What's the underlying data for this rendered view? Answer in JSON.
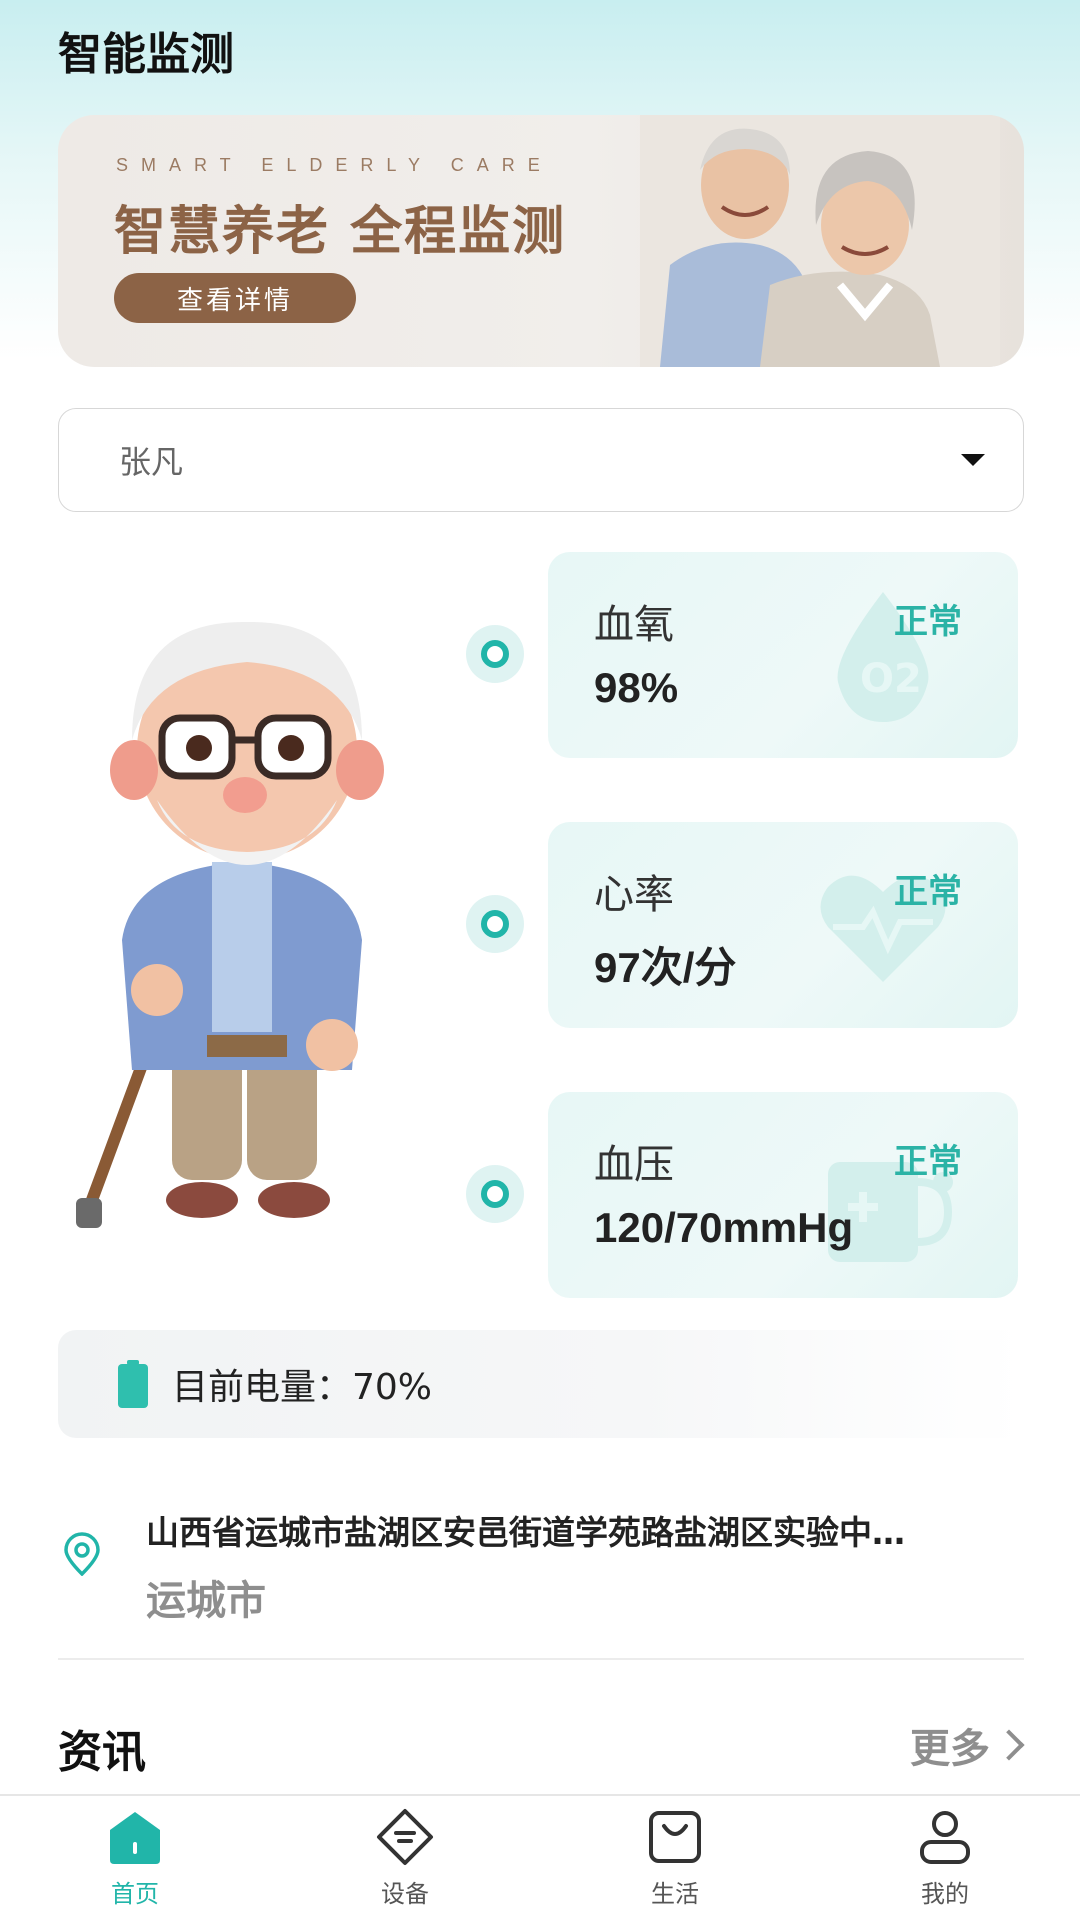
{
  "header": {
    "title": "智能监测"
  },
  "banner": {
    "subtitle": "SMART ELDERLY CARE",
    "headline": "智慧养老 全程监测",
    "button_label": "查看详情"
  },
  "selector": {
    "value": "张凡"
  },
  "metrics": [
    {
      "label": "血氧",
      "status": "正常",
      "value": "98%",
      "icon": "oxygen-drop-icon"
    },
    {
      "label": "心率",
      "status": "正常",
      "value": "97次/分",
      "icon": "heart-pulse-icon"
    },
    {
      "label": "血压",
      "status": "正常",
      "value": "120/70mmHg",
      "icon": "medical-kit-icon"
    }
  ],
  "battery": {
    "text": "目前电量：70%",
    "level": 0.7
  },
  "location": {
    "address": "山西省运城市盐湖区安邑街道学苑路盐湖区实验中…",
    "city": "运城市"
  },
  "news": {
    "title": "资讯",
    "more_label": "更多"
  },
  "tabs": [
    {
      "label": "首页",
      "icon": "home-icon",
      "active": true
    },
    {
      "label": "设备",
      "icon": "device-icon",
      "active": false
    },
    {
      "label": "生活",
      "icon": "shopping-bag-icon",
      "active": false
    },
    {
      "label": "我的",
      "icon": "user-icon",
      "active": false
    }
  ],
  "colors": {
    "accent": "#21b5a9",
    "banner_brown": "#8c6346",
    "status_green": "#2bb3a6"
  }
}
